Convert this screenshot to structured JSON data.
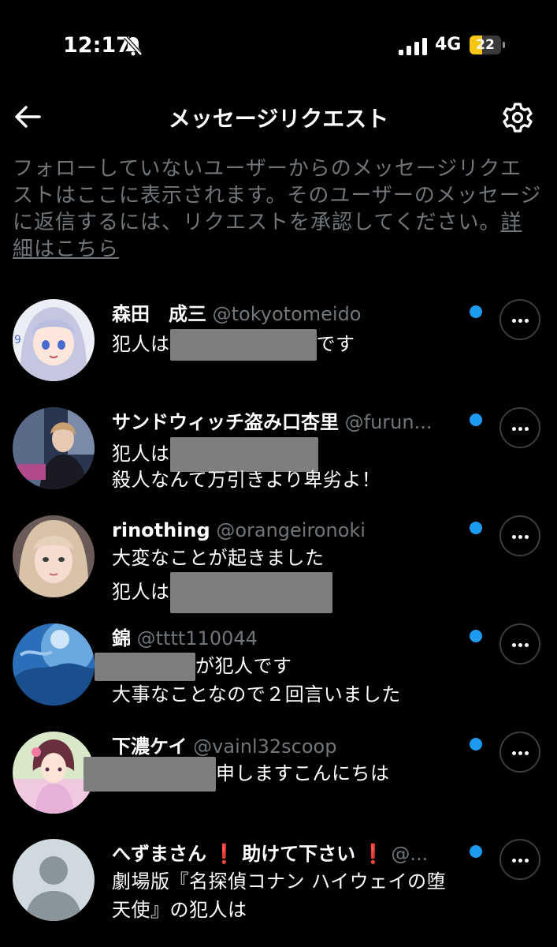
{
  "status_bar": {
    "time": "12:17",
    "network": "4G",
    "battery": "22"
  },
  "header": {
    "title": "メッセージリクエスト"
  },
  "intro": {
    "text": "フォローしていないユーザーからのメッセージリクエストはここに表示されます。そのユーザーのメッセージに返信するには、リクエストを承認してください。",
    "link": "詳細はこちら"
  },
  "requests": [
    {
      "name": "森田　成三",
      "handle": "@tokyotomeido",
      "line1_pre": "犯人は",
      "line1_post": "です",
      "line2": ""
    },
    {
      "name": "サンドウィッチ盗み口杏里",
      "handle": "@furun...",
      "line1_pre": "犯人は",
      "line1_post": "",
      "line2": "殺人なんて万引きより卑劣よ！"
    },
    {
      "name": "rinothing",
      "handle": "@orangeironoki",
      "line1_pre": "大変なことが起きました",
      "line1_post": "",
      "line2": "犯人は"
    },
    {
      "name": "錦",
      "handle": "@tttt110044",
      "line1_pre": "",
      "line1_post": "が犯人です",
      "line2": "大事なことなので２回言いました"
    },
    {
      "name": "下濃ケイ",
      "handle": "@vainl32scoop",
      "line1_pre": "",
      "line1_post": "申しますこんにちは",
      "line2": ""
    },
    {
      "name_pre": "へずまさん",
      "name_mid": "助けて下さい",
      "handle": "@...",
      "line1_pre": "劇場版『名探偵コナン ハイウェイの堕",
      "line1_post": "",
      "line2": "天使』の犯人は"
    }
  ],
  "colors": {
    "background": "#000000",
    "text": "#e7e9ea",
    "muted": "#71767b",
    "accent": "#1d9bf0",
    "redaction": "#7e7e7e"
  },
  "icons": {
    "back": "arrow-left-icon",
    "settings": "gear-icon",
    "mute": "bell-slash-icon",
    "more": "more-horizontal-icon",
    "unread": "unread-dot-icon"
  }
}
